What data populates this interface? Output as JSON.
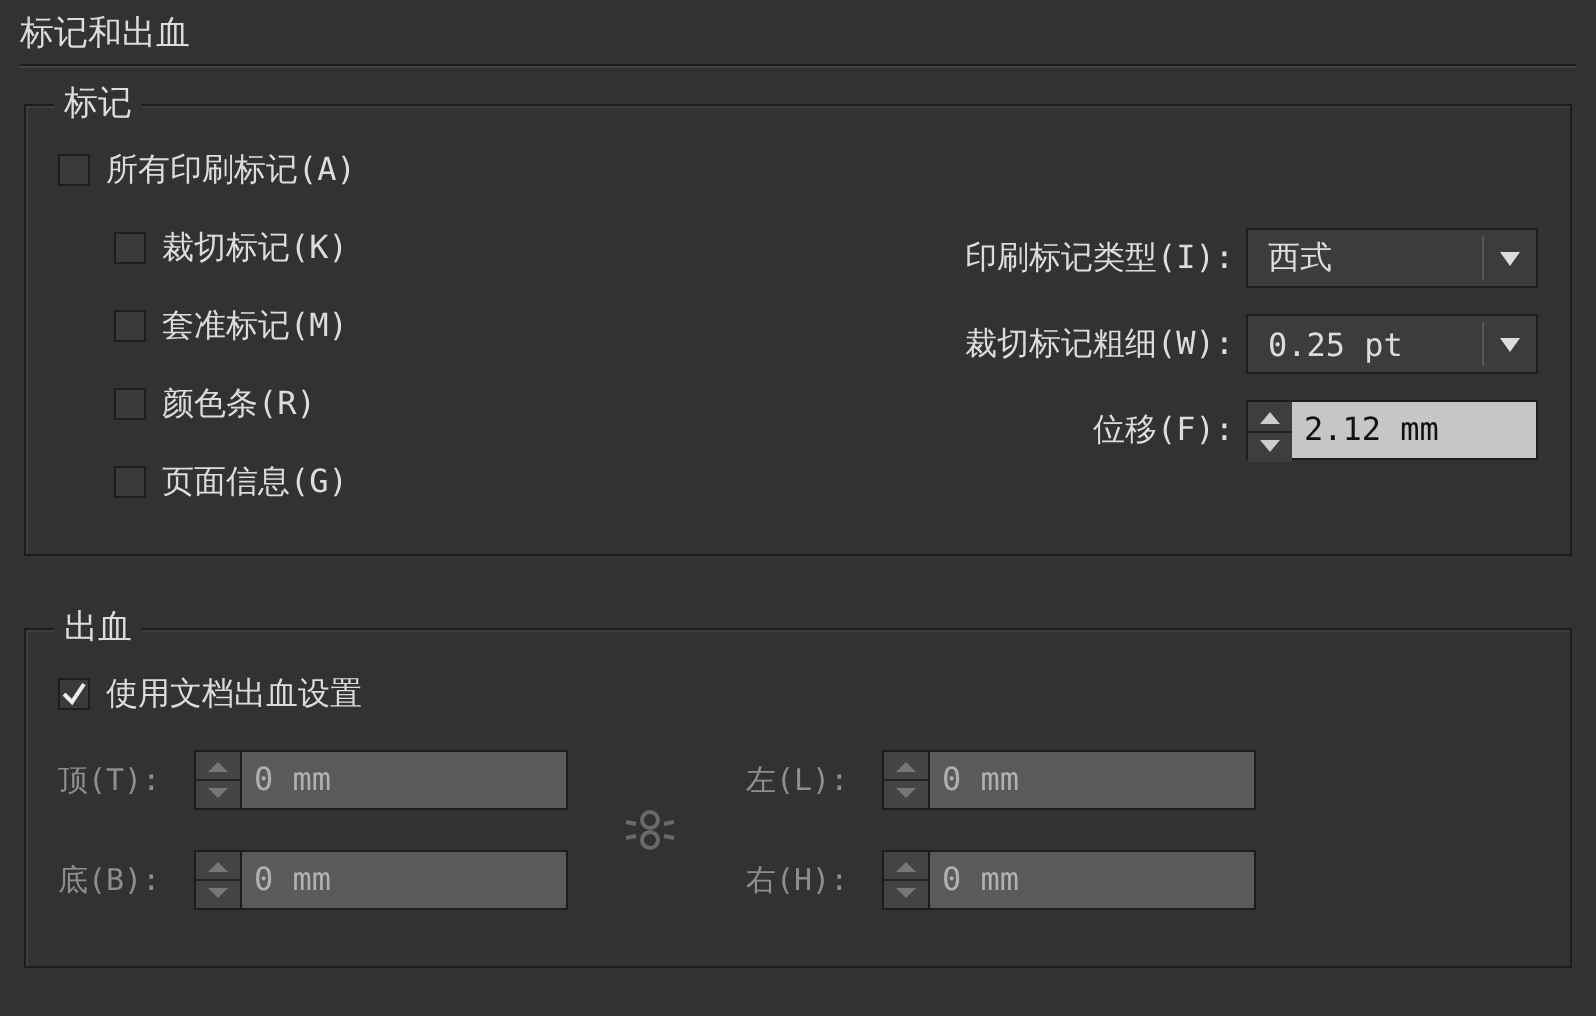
{
  "title": "标记和出血",
  "marks": {
    "legend": "标记",
    "all": {
      "label": "所有印刷标记(A)",
      "checked": false
    },
    "options": [
      {
        "label": "裁切标记(K)",
        "checked": false
      },
      {
        "label": "套准标记(M)",
        "checked": false
      },
      {
        "label": "颜色条(R)",
        "checked": false
      },
      {
        "label": "页面信息(G)",
        "checked": false
      }
    ],
    "settings": [
      {
        "kind": "dropdown",
        "label": "印刷标记类型(I):",
        "value": "西式"
      },
      {
        "kind": "dropdown",
        "label": "裁切标记粗细(W):",
        "value": "0.25 pt"
      },
      {
        "kind": "spinner",
        "label": "位移(F):",
        "value": "2.12 mm"
      }
    ]
  },
  "bleed": {
    "legend": "出血",
    "use_document": {
      "label": "使用文档出血设置",
      "checked": true
    },
    "fields": [
      {
        "label": "顶(T):",
        "value": "0 mm",
        "disabled": true
      },
      {
        "label": "左(L):",
        "value": "0 mm",
        "disabled": true
      },
      {
        "label": "底(B):",
        "value": "0 mm",
        "disabled": true
      },
      {
        "label": "右(H):",
        "value": "0 mm",
        "disabled": true
      }
    ]
  }
}
